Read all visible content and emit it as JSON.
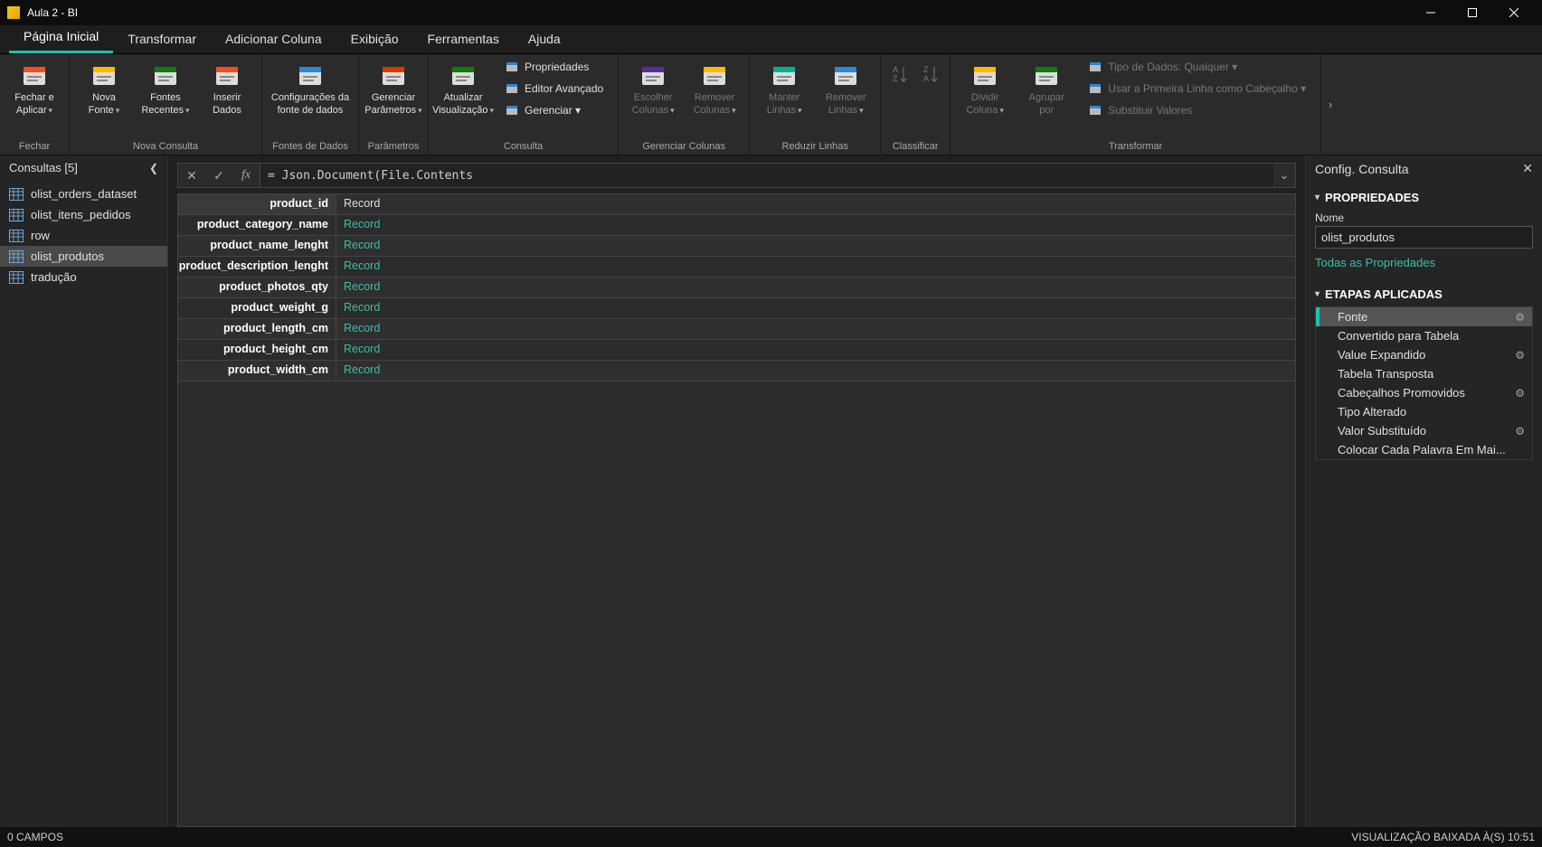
{
  "title": "Aula 2 - BI",
  "tabs": [
    "Página Inicial",
    "Transformar",
    "Adicionar Coluna",
    "Exibição",
    "Ferramentas",
    "Ajuda"
  ],
  "active_tab": 0,
  "ribbon": {
    "groups": [
      {
        "label": "Fechar",
        "buttons": [
          {
            "text": "Fechar e\nAplicar",
            "caret": true
          }
        ]
      },
      {
        "label": "Nova Consulta",
        "buttons": [
          {
            "text": "Nova\nFonte",
            "caret": true
          },
          {
            "text": "Fontes\nRecentes",
            "caret": true
          },
          {
            "text": "Inserir\nDados"
          }
        ]
      },
      {
        "label": "Fontes de Dados",
        "buttons": [
          {
            "text": "Configurações da\nfonte de dados",
            "wide": true
          }
        ]
      },
      {
        "label": "Parâmetros",
        "buttons": [
          {
            "text": "Gerenciar\nParâmetros",
            "caret": true
          }
        ]
      },
      {
        "label": "Consulta",
        "buttons": [
          {
            "text": "Atualizar\nVisualização",
            "caret": true
          }
        ],
        "mini": [
          {
            "text": "Propriedades"
          },
          {
            "text": "Editor Avançado"
          },
          {
            "text": "Gerenciar",
            "caret": true
          }
        ]
      },
      {
        "label": "Gerenciar Colunas",
        "buttons": [
          {
            "text": "Escolher\nColunas",
            "caret": true,
            "dim": true
          },
          {
            "text": "Remover\nColunas",
            "caret": true,
            "dim": true
          }
        ]
      },
      {
        "label": "Reduzir Linhas",
        "buttons": [
          {
            "text": "Manter\nLinhas",
            "caret": true,
            "dim": true
          },
          {
            "text": "Remover\nLinhas",
            "caret": true,
            "dim": true
          }
        ]
      },
      {
        "label": "Classificar",
        "buttons": [
          {
            "text": "",
            "sort_asc": true,
            "dim": true,
            "narrow": true
          },
          {
            "text": "",
            "sort_desc": true,
            "dim": true,
            "narrow": true
          }
        ]
      },
      {
        "label": "Transformar",
        "buttons": [
          {
            "text": "Dividir\nColuna",
            "caret": true,
            "dim": true
          },
          {
            "text": "Agrupar\npor",
            "dim": true
          }
        ],
        "mini": [
          {
            "text": "Tipo de Dados: Qualquer",
            "caret": true,
            "dim": true
          },
          {
            "text": "Usar a Primeira Linha como Cabeçalho",
            "caret": true,
            "dim": true
          },
          {
            "text": "Substituir Valores",
            "dim": true
          }
        ]
      }
    ]
  },
  "queries": {
    "title": "Consultas [5]",
    "items": [
      "olist_orders_dataset",
      "olist_itens_pedidos",
      "row",
      "olist_produtos",
      "tradução"
    ],
    "selected": 3
  },
  "formula": "= Json.Document(File.Contents",
  "grid_rows": [
    {
      "key": "product_id",
      "val": "Record",
      "link": false
    },
    {
      "key": "product_category_name",
      "val": "Record",
      "link": true
    },
    {
      "key": "product_name_lenght",
      "val": "Record",
      "link": true
    },
    {
      "key": "product_description_lenght",
      "val": "Record",
      "link": true
    },
    {
      "key": "product_photos_qty",
      "val": "Record",
      "link": true
    },
    {
      "key": "product_weight_g",
      "val": "Record",
      "link": true
    },
    {
      "key": "product_length_cm",
      "val": "Record",
      "link": true
    },
    {
      "key": "product_height_cm",
      "val": "Record",
      "link": true
    },
    {
      "key": "product_width_cm",
      "val": "Record",
      "link": true
    }
  ],
  "settings": {
    "title": "Config. Consulta",
    "props_header": "PROPRIEDADES",
    "name_label": "Nome",
    "name_value": "olist_produtos",
    "all_props": "Todas as Propriedades",
    "steps_header": "ETAPAS APLICADAS",
    "steps": [
      {
        "name": "Fonte",
        "gear": true,
        "sel": true
      },
      {
        "name": "Convertido para Tabela",
        "gear": false
      },
      {
        "name": "Value Expandido",
        "gear": true
      },
      {
        "name": "Tabela Transposta",
        "gear": false
      },
      {
        "name": "Cabeçalhos Promovidos",
        "gear": true
      },
      {
        "name": "Tipo Alterado",
        "gear": false
      },
      {
        "name": "Valor Substituído",
        "gear": true
      },
      {
        "name": "Colocar Cada Palavra Em Mai...",
        "gear": false
      }
    ]
  },
  "status": {
    "left": "0 CAMPOS",
    "right": "VISUALIZAÇÃO BAIXADA À(S) 10:51"
  }
}
